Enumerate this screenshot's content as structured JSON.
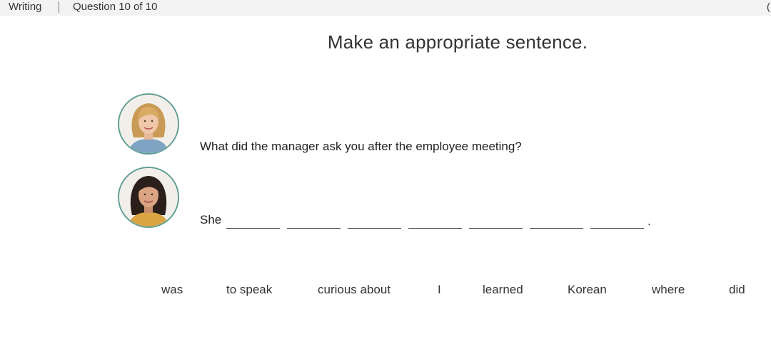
{
  "header": {
    "section": "Writing",
    "question_counter": "Question 10 of 10",
    "edge_mark": "("
  },
  "instruction": "Make an appropriate sentence.",
  "dialogue": {
    "question": "What did the manager ask you after the employee meeting?",
    "answer_start": "She",
    "answer_end": "."
  },
  "word_bank": [
    "was",
    "to speak",
    "curious about",
    "I",
    "learned",
    "Korean",
    "where",
    "did"
  ],
  "colors": {
    "topbar": "#f3f3f3",
    "avatar_border": "#5f9e94",
    "text": "#222222"
  }
}
